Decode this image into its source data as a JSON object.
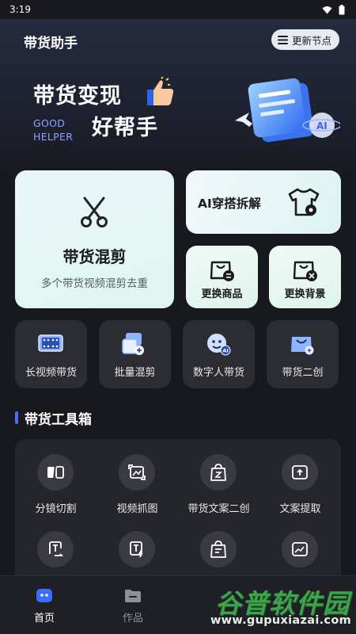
{
  "status_bar": {
    "time": "3:19"
  },
  "header": {
    "title": "带货助手",
    "update_button": "更新节点"
  },
  "banner": {
    "title": "带货变现",
    "subtitle": "好帮手",
    "english_line1": "GOOD",
    "english_line2": "HELPER",
    "badge": "AI"
  },
  "feature_cards": {
    "mix": {
      "title": "带货混剪",
      "desc": "多个带货视频混剪去重"
    },
    "ai_outfit": {
      "title": "AI穿搭拆解"
    },
    "replace_goods": {
      "title": "更换商品"
    },
    "replace_bg": {
      "title": "更换背景"
    }
  },
  "quick_actions": [
    {
      "label": "长视频带货",
      "icon": "film-icon"
    },
    {
      "label": "批量混剪",
      "icon": "batch-icon"
    },
    {
      "label": "数字人带货",
      "icon": "digital-human-icon"
    },
    {
      "label": "带货二创",
      "icon": "shopping-bag-icon"
    }
  ],
  "toolbox": {
    "title": "带货工具箱",
    "tools": [
      {
        "label": "分镜切割",
        "icon": "split-icon"
      },
      {
        "label": "视频抓图",
        "icon": "capture-icon"
      },
      {
        "label": "带货文案二创",
        "icon": "copy-bag-icon"
      },
      {
        "label": "文案提取",
        "icon": "extract-icon"
      },
      {
        "label": "",
        "icon": "text-refresh-icon"
      },
      {
        "label": "",
        "icon": "text-flash-icon"
      },
      {
        "label": "",
        "icon": "bag-text-icon"
      },
      {
        "label": "",
        "icon": "image-icon"
      }
    ]
  },
  "bottom_nav": {
    "items": [
      {
        "label": "首页",
        "active": true
      },
      {
        "label": "作品",
        "active": false
      }
    ]
  },
  "watermark": {
    "text": "谷普软件园",
    "url": "www.gupuxiazai.com"
  },
  "colors": {
    "accent": "#4a6cff",
    "card_mint": "#dff4ef",
    "background": "#18191e"
  }
}
